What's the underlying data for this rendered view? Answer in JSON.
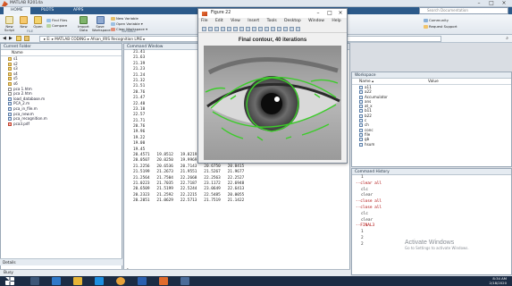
{
  "app": {
    "title": "MATLAB R2014a"
  },
  "tabs": [
    "HOME",
    "PLOTS",
    "APPS"
  ],
  "ribbon": {
    "new_script": "New Script",
    "new": "New",
    "open": "Open",
    "find_files": "Find Files",
    "compare": "Compare",
    "import_data": "Import Data",
    "save_workspace": "Save Workspace",
    "new_variable": "New Variable",
    "open_variable": "Open Variable ▾",
    "clear_workspace": "Clear Workspace ▾",
    "section_file": "FILE",
    "section_variable": "VARIABLE",
    "community": "Community",
    "request_support": "Request Support"
  },
  "search": {
    "placeholder": "Search Documentation"
  },
  "address": {
    "path": "▸ E: ▸ MATLAB CODING ▸ Afsan_IRIS Recognition LPIE ▸"
  },
  "current_folder": {
    "title": "Current Folder",
    "col_name": "Name",
    "items": [
      {
        "name": "s1",
        "type": "dir"
      },
      {
        "name": "s2",
        "type": "dir"
      },
      {
        "name": "s3",
        "type": "dir"
      },
      {
        "name": "s4",
        "type": "dir"
      },
      {
        "name": "s5",
        "type": "dir"
      },
      {
        "name": "s6",
        "type": "dir"
      },
      {
        "name": "pca 1.htm",
        "type": "file"
      },
      {
        "name": "pca 2.htm",
        "type": "file"
      },
      {
        "name": "load_database.m",
        "type": "m"
      },
      {
        "name": "PCA_2.m",
        "type": "m"
      },
      {
        "name": "pca_in_file.m",
        "type": "m"
      },
      {
        "name": "pca_new.m",
        "type": "m"
      },
      {
        "name": "pca_recognition.m",
        "type": "m"
      },
      {
        "name": "pca3.pdf",
        "type": "pdf"
      }
    ],
    "details_label": "Details"
  },
  "command_window": {
    "title": "Command Window",
    "prompt": "fx",
    "lines": [
      "21.41",
      "21.63",
      "21.39",
      "21.23",
      "21.24",
      "21.32",
      "21.51",
      "20.76",
      "21.47",
      "22.40",
      "23.10",
      "22.57",
      "21.71",
      "20.76",
      "19.96",
      "19.22",
      "19.00",
      "19.45",
      "20.4571   19.8512   19.8219   20.2469   19.6943",
      "20.0507   20.0250   19.9969   20.8250   19.9420",
      "21.2256   20.6536   20.7143   20.6750   20.8415",
      "21.5199   21.2673   21.9551   21.5267   21.9677",
      "21.2564   21.7504   22.2668   22.2563   22.2527",
      "21.0223   21.7035   22.7187   23.1172   22.6948",
      "20.6509   21.5199   22.5244   23.0649   22.6413",
      "20.2323   21.2592   22.2215   22.5485   20.0055",
      "20.2051   21.0629   22.5713   21.7519   21.1422"
    ]
  },
  "figure": {
    "window_title": "Figure 22",
    "title": "Final contour, 40 iterations",
    "menu": [
      "File",
      "Edit",
      "View",
      "Insert",
      "Tools",
      "Desktop",
      "Window",
      "Help"
    ]
  },
  "workspace": {
    "title": "Workspace",
    "col_name": "Name ▴",
    "col_value": "Value",
    "items": [
      "a11",
      "a22",
      "Accumulator",
      "ans",
      "at_x",
      "b11",
      "b22",
      "c",
      "ch",
      "conc",
      "file",
      "gb",
      "hsum"
    ]
  },
  "history": {
    "title": "Command History",
    "items": [
      {
        "text": "1",
        "sess": false
      },
      {
        "text": "--clear all",
        "sess": true
      },
      {
        "text": "clc",
        "sess": false
      },
      {
        "text": "clear",
        "sess": false
      },
      {
        "text": "--close all",
        "sess": true
      },
      {
        "text": "--close all",
        "sess": true
      },
      {
        "text": "clc",
        "sess": false
      },
      {
        "text": "clear",
        "sess": false
      },
      {
        "text": "--FINAL3",
        "sess": true
      },
      {
        "text": "1",
        "sess": false
      },
      {
        "text": "2",
        "sess": false
      },
      {
        "text": "2",
        "sess": false
      }
    ]
  },
  "activate": {
    "line1": "Activate Windows",
    "line2": "Go to Settings to activate Windows."
  },
  "status": {
    "text": "Busy"
  },
  "clock": {
    "time": "8:34 AM",
    "date": "2/18/2020"
  },
  "colors": {
    "contour": "#3ccc2a",
    "ribbon_tab": "#2c5a8a",
    "taskbar": "#1c2c44"
  }
}
